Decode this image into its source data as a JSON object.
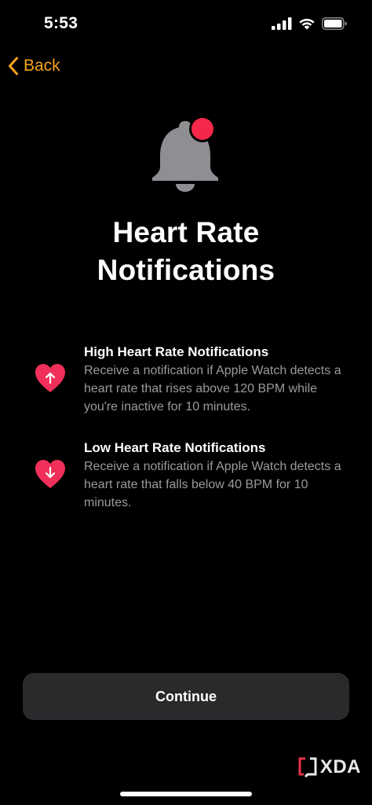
{
  "status_bar": {
    "time": "5:53"
  },
  "nav": {
    "back_label": "Back"
  },
  "hero": {
    "title_line1": "Heart Rate",
    "title_line2": "Notifications"
  },
  "features": [
    {
      "title": "High Heart Rate Notifications",
      "description": "Receive a notification if Apple Watch detects a heart rate that rises above 120 BPM while you're inactive for 10 minutes.",
      "icon": "heart-arrow-up-icon"
    },
    {
      "title": "Low Heart Rate Notifications",
      "description": "Receive a notification if Apple Watch detects a heart rate that falls below 40 BPM for 10 minutes.",
      "icon": "heart-arrow-down-icon"
    }
  ],
  "actions": {
    "continue_label": "Continue"
  },
  "watermark": {
    "text": "XDA"
  },
  "colors": {
    "background": "#000000",
    "accent": "#f4a31a",
    "heart": "#f0305a",
    "bell": "#8e8e93",
    "badge": "#f5284b",
    "button_bg": "#2a2a2d",
    "secondary_text": "#9a9a9e"
  }
}
